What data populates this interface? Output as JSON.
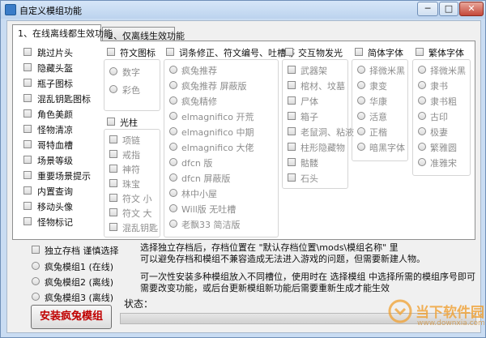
{
  "window": {
    "title": "自定义模组功能",
    "minimize": "─",
    "maximize": "□",
    "close": "✕"
  },
  "tabs": [
    {
      "label": "1、在线离线都生效功能"
    },
    {
      "label": "2、仅离线生效功能"
    }
  ],
  "col1": [
    "跳过片头",
    "隐藏头盔",
    "瓶子图标",
    "混乱钥匙图标",
    "角色美颜",
    "怪物清凉",
    "哥特血槽",
    "场景等级",
    "重要场景提示",
    "内置查询",
    "移动头像",
    "怪物标记"
  ],
  "rune": {
    "header": "符文图标",
    "options": [
      "数字",
      "彩色"
    ]
  },
  "pillar": {
    "header": "光柱",
    "items": [
      "项链",
      "戒指",
      "神符",
      "珠宝",
      "符文 小",
      "符文 大",
      "混乱钥匙"
    ]
  },
  "mod": {
    "header": "词条修正、符文编号、吐槽等",
    "options": [
      "疯兔推荐",
      "疯兔推荐 屏蔽版",
      "疯兔精修",
      "elmagnifico 开荒",
      "elmagnifico 中期",
      "elmagnifico 大佬",
      "dfcn 版",
      "dfcn 屏蔽版",
      "林中小屋",
      "Will版 无吐槽",
      "老飘33 简洁版"
    ]
  },
  "light": {
    "header": "交互物发光",
    "items": [
      "武器架",
      "棺材、坟墓",
      "尸体",
      "箱子",
      "老鼠洞、粘液",
      "柱形隐藏物",
      "骷髅",
      "石头"
    ]
  },
  "simp": {
    "header": "简体字体",
    "options": [
      "择微米黑",
      "隶变",
      "华康",
      "活意",
      "正楷",
      "暗黑字体"
    ]
  },
  "trad": {
    "header": "繁体字体",
    "options": [
      "择微米黑",
      "隶书",
      "隶书粗",
      "古印",
      "极妻",
      "繁雅圆",
      "准雅宋"
    ]
  },
  "bottom": {
    "independent": "独立存档 谨慎选择",
    "slots": [
      "疯兔模组1 (在线)",
      "疯兔模组2 (离线)",
      "疯兔模组3 (离线)"
    ],
    "install": "安装疯兔模组",
    "status": "状态：",
    "note1": "选择独立存档后，存档位置在 \"默认存档位置\\mods\\模组名称\" 里",
    "note2": "可以避免存档和模组不兼容造成无法进入游戏的问题，但需要新建人物。",
    "note3": "可一次性安装多种模组放入不同槽位，使用时在 选择模组 中选择所需的模组序号即可",
    "note4": "需要改变功能，或后台更新模组新功能后需要重新生成才能生效"
  },
  "watermark": {
    "t1": "当下软件园",
    "t2": "www.downxia.com"
  }
}
